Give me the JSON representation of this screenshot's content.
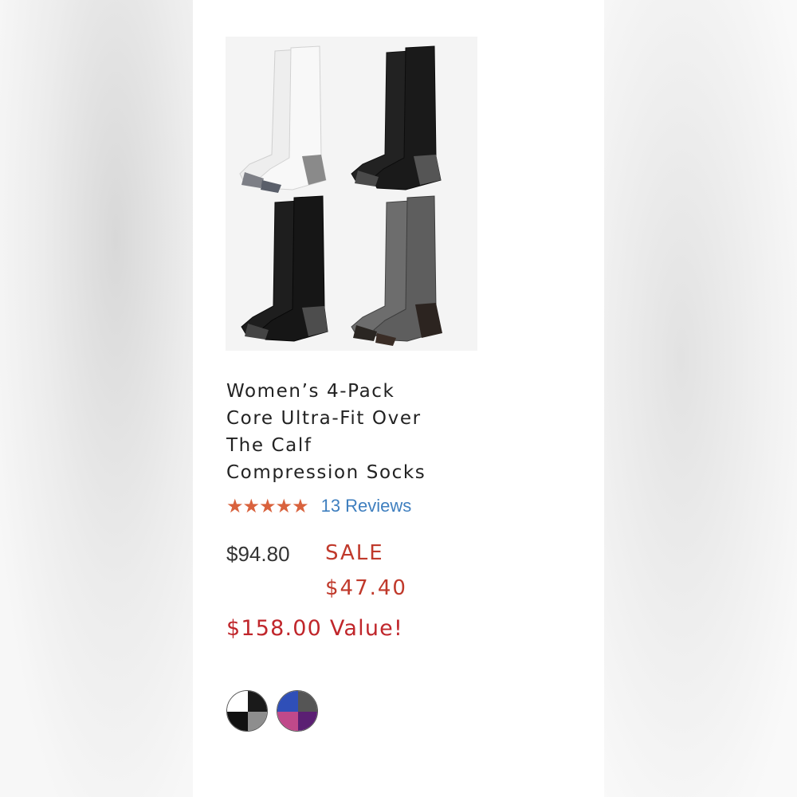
{
  "product": {
    "image_alt": "Four pairs of over the calf compression socks: white, black, black, heather grey",
    "title": "Women’s 4-Pack\nCore Ultra-Fit Over\nThe Calf\nCompression Socks",
    "stars": "★★★★★",
    "rating": 5,
    "reviews_label": "13 Reviews",
    "original_price": "$94.80",
    "sale_label": "SALE",
    "sale_price": "$47.40",
    "value_text": "$158.00 Value!"
  },
  "swatches": [
    {
      "name": "white-black-grey",
      "colors": [
        "#ffffff",
        "#1a1a1a",
        "#111111",
        "#8e8e8e"
      ]
    },
    {
      "name": "blue-grey-pink-purple",
      "colors": [
        "#2f4fb8",
        "#555555",
        "#c0498a",
        "#5b1f73"
      ]
    }
  ],
  "colors": {
    "accent_star": "#d9623d",
    "link": "#3f7fbf",
    "sale": "#c0392b"
  }
}
